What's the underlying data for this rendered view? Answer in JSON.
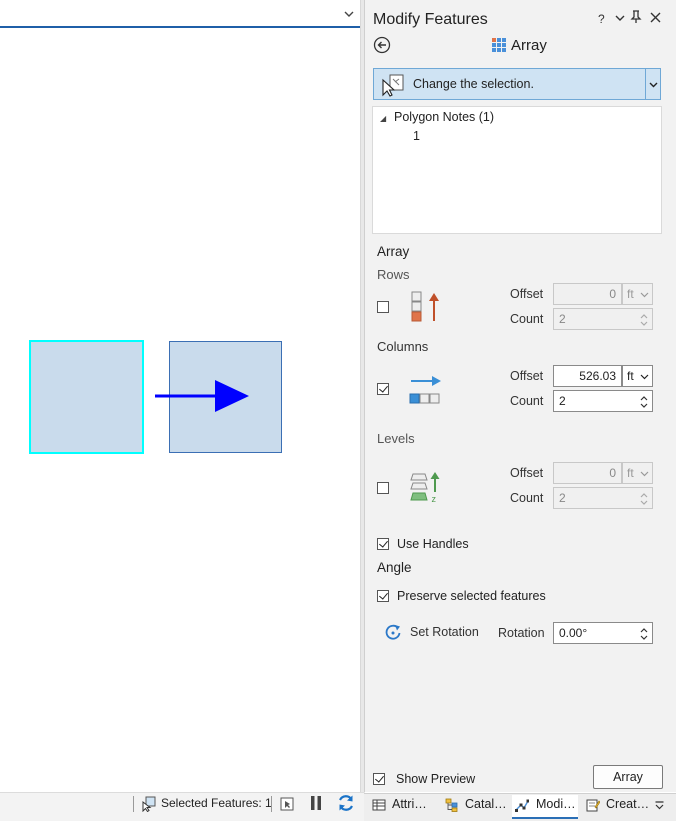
{
  "map": {
    "status": {
      "selected_features": "Selected Features: 1"
    }
  },
  "pane": {
    "title": "Modify Features",
    "help": "?",
    "tool_name": "Array",
    "selection": {
      "label": "Change the selection.",
      "tree": {
        "layer": "Polygon Notes (1)",
        "items": [
          "1"
        ]
      }
    },
    "array": {
      "heading": "Array",
      "rows": {
        "label": "Rows",
        "checked": false,
        "offset_label": "Offset",
        "offset": "0",
        "offset_unit": "ft",
        "count_label": "Count",
        "count": "2"
      },
      "columns": {
        "label": "Columns",
        "checked": true,
        "offset_label": "Offset",
        "offset": "526.03",
        "offset_unit": "ft",
        "count_label": "Count",
        "count": "2"
      },
      "levels": {
        "label": "Levels",
        "checked": false,
        "offset_label": "Offset",
        "offset": "0",
        "offset_unit": "ft",
        "count_label": "Count",
        "count": "2"
      },
      "use_handles": {
        "label": "Use Handles",
        "checked": true
      }
    },
    "angle": {
      "heading": "Angle",
      "preserve": {
        "label": "Preserve selected features",
        "checked": true
      },
      "set_rotation": "Set Rotation",
      "rotation_label": "Rotation",
      "rotation": "0.00°"
    },
    "show_preview": {
      "label": "Show Preview",
      "checked": true
    },
    "apply_button": "Array"
  },
  "tabs": [
    {
      "label": "Attri…"
    },
    {
      "label": "Catal…"
    },
    {
      "label": "Modi…"
    },
    {
      "label": "Creat…"
    }
  ],
  "colors": {
    "accent": "#2b6fb6",
    "selection_outline": "#00ffff",
    "arrow": "#0000ff",
    "polygon_fill": "#c9dbec"
  }
}
